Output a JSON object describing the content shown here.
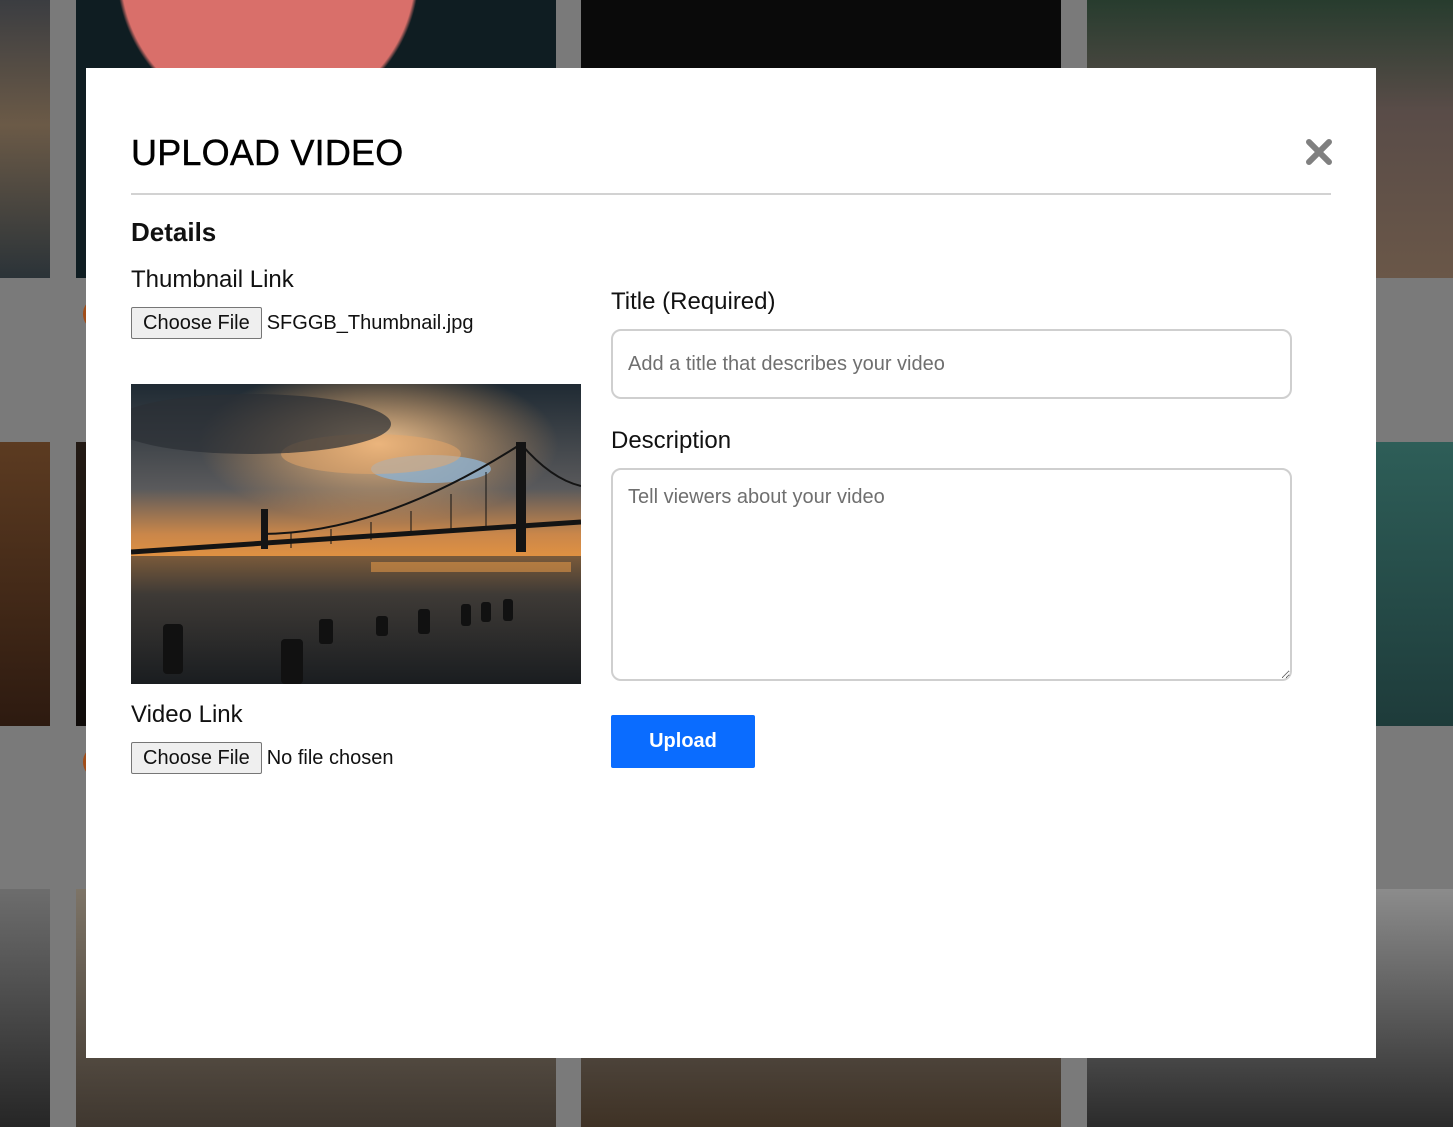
{
  "modal": {
    "title": "UPLOAD VIDEO",
    "section_title": "Details",
    "thumbnail": {
      "label": "Thumbnail Link",
      "button_label": "Choose File",
      "file_name": "SFGGB_Thumbnail.jpg"
    },
    "video": {
      "label": "Video Link",
      "button_label": "Choose File",
      "file_name": "No file chosen"
    },
    "title_field": {
      "label": "Title (Required)",
      "placeholder": "Add a title that describes your video",
      "value": ""
    },
    "description_field": {
      "label": "Description",
      "placeholder": "Tell viewers about your video",
      "value": ""
    },
    "upload_label": "Upload"
  },
  "colors": {
    "accent": "#0a6cff",
    "close_icon": "#808080",
    "divider": "#d2d2d2"
  },
  "icons": {
    "close": "close-icon",
    "thumbnail_preview": "bridge-sunset-image"
  }
}
